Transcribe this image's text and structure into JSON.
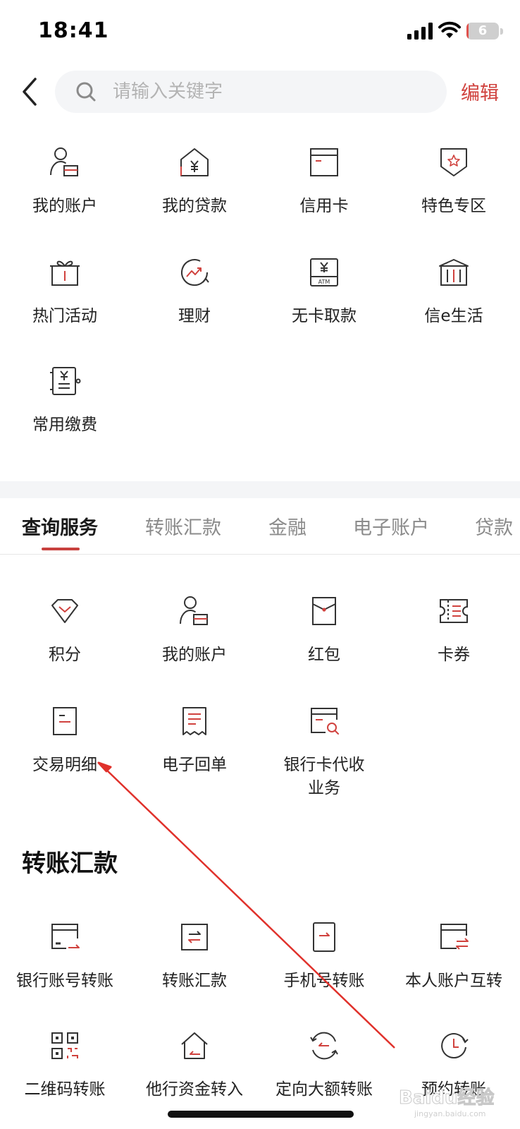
{
  "status_bar": {
    "time": "18:41",
    "battery": "6",
    "battery_level": 0.06
  },
  "search": {
    "placeholder": "请输入关键字",
    "edit_label": "编辑"
  },
  "quick_menu": [
    {
      "label": "我的账户",
      "icon": "account-icon"
    },
    {
      "label": "我的贷款",
      "icon": "loan-house-icon"
    },
    {
      "label": "信用卡",
      "icon": "credit-card-icon"
    },
    {
      "label": "特色专区",
      "icon": "star-badge-icon"
    },
    {
      "label": "热门活动",
      "icon": "gift-icon"
    },
    {
      "label": "理财",
      "icon": "wealth-chart-icon"
    },
    {
      "label": "无卡取款",
      "icon": "atm-icon"
    },
    {
      "label": "信e生活",
      "icon": "bank-building-icon"
    },
    {
      "label": "常用缴费",
      "icon": "payment-bill-icon"
    }
  ],
  "tabs": [
    {
      "label": "查询服务",
      "active": true
    },
    {
      "label": "转账汇款",
      "active": false
    },
    {
      "label": "金融",
      "active": false
    },
    {
      "label": "电子账户",
      "active": false
    },
    {
      "label": "贷款",
      "active": false
    }
  ],
  "query_services": [
    {
      "label": "积分",
      "icon": "diamond-icon"
    },
    {
      "label": "我的账户",
      "icon": "account-icon"
    },
    {
      "label": "红包",
      "icon": "red-envelope-icon"
    },
    {
      "label": "卡券",
      "icon": "coupon-icon"
    },
    {
      "label": "交易明细",
      "icon": "transaction-detail-icon"
    },
    {
      "label": "电子回单",
      "icon": "receipt-icon"
    },
    {
      "label": "银行卡代收\n业务",
      "label_lines": [
        "银行卡代收",
        "业务"
      ],
      "icon": "card-search-icon"
    }
  ],
  "transfer_section": {
    "title": "转账汇款",
    "items": [
      {
        "label": "银行账号转账",
        "icon": "account-transfer-icon"
      },
      {
        "label": "转账汇款",
        "icon": "transfer-icon"
      },
      {
        "label": "手机号转账",
        "icon": "phone-transfer-icon"
      },
      {
        "label": "本人账户互转",
        "icon": "card-exchange-icon"
      },
      {
        "label": "二维码转账",
        "icon": "qr-code-icon"
      },
      {
        "label": "他行资金转入",
        "icon": "house-arrow-icon"
      },
      {
        "label": "定向大额转账",
        "icon": "cycle-transfer-icon"
      },
      {
        "label": "预约转账",
        "icon": "clock-icon"
      }
    ]
  },
  "watermark": {
    "text": "Baidu经验",
    "sub": "jingyan.baidu.com"
  },
  "colors": {
    "accent": "#d0423e",
    "icon_stroke": "#333333",
    "tab_inactive": "#8b8b8b",
    "annotation_arrow": "#e0312b"
  }
}
